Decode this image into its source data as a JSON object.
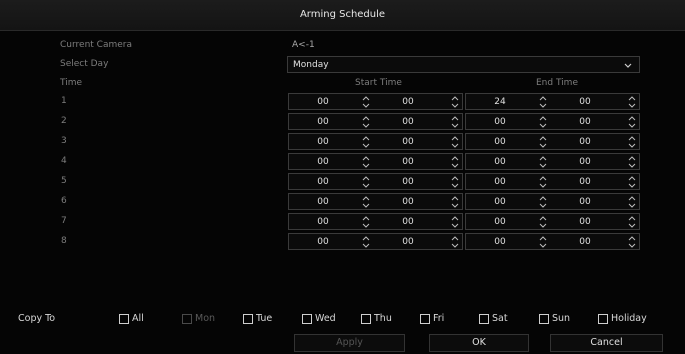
{
  "dialog": {
    "title": "Arming Schedule"
  },
  "fields": {
    "current_camera_label": "Current Camera",
    "current_camera_value": "A<-1",
    "select_day_label": "Select Day",
    "select_day_value": "Monday",
    "time_label": "Time"
  },
  "columns": {
    "start": "Start Time",
    "end": "End Time"
  },
  "rows": [
    {
      "label": "1",
      "sh": "00",
      "sm": "00",
      "eh": "24",
      "em": "00"
    },
    {
      "label": "2",
      "sh": "00",
      "sm": "00",
      "eh": "00",
      "em": "00"
    },
    {
      "label": "3",
      "sh": "00",
      "sm": "00",
      "eh": "00",
      "em": "00"
    },
    {
      "label": "4",
      "sh": "00",
      "sm": "00",
      "eh": "00",
      "em": "00"
    },
    {
      "label": "5",
      "sh": "00",
      "sm": "00",
      "eh": "00",
      "em": "00"
    },
    {
      "label": "6",
      "sh": "00",
      "sm": "00",
      "eh": "00",
      "em": "00"
    },
    {
      "label": "7",
      "sh": "00",
      "sm": "00",
      "eh": "00",
      "em": "00"
    },
    {
      "label": "8",
      "sh": "00",
      "sm": "00",
      "eh": "00",
      "em": "00"
    }
  ],
  "copy_to": {
    "label": "Copy To",
    "options": [
      {
        "label": "All",
        "checked": false,
        "disabled": false
      },
      {
        "label": "Mon",
        "checked": false,
        "disabled": true
      },
      {
        "label": "Tue",
        "checked": false,
        "disabled": false
      },
      {
        "label": "Wed",
        "checked": false,
        "disabled": false
      },
      {
        "label": "Thu",
        "checked": false,
        "disabled": false
      },
      {
        "label": "Fri",
        "checked": false,
        "disabled": false
      },
      {
        "label": "Sat",
        "checked": false,
        "disabled": false
      },
      {
        "label": "Sun",
        "checked": false,
        "disabled": false
      },
      {
        "label": "Holiday",
        "checked": false,
        "disabled": false
      }
    ]
  },
  "buttons": {
    "apply": "Apply",
    "ok": "OK",
    "cancel": "Cancel"
  },
  "icons": {
    "spinner": "up-down-spinner-icon",
    "dropdown": "chevron-down-icon"
  }
}
